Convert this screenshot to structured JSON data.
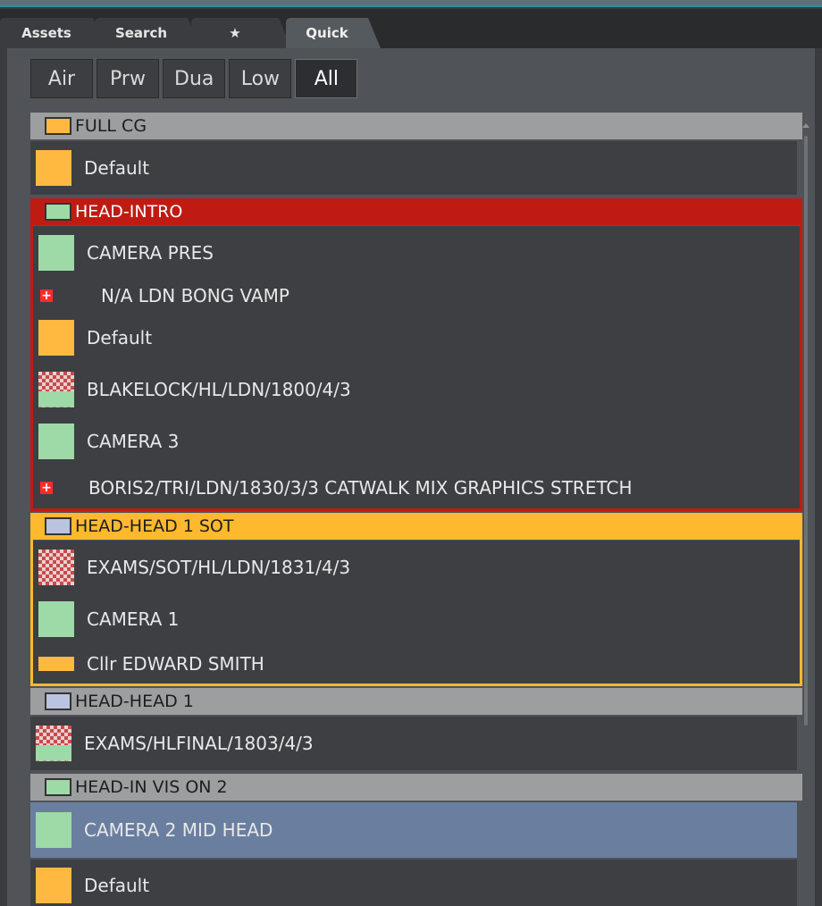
{
  "tabs": [
    {
      "label": "Assets",
      "active": false
    },
    {
      "label": "Search",
      "active": false
    },
    {
      "label": "★",
      "active": false
    },
    {
      "label": "Quick",
      "active": true
    }
  ],
  "filters": [
    {
      "label": "Air",
      "selected": false
    },
    {
      "label": "Prw",
      "selected": false
    },
    {
      "label": "Dua",
      "selected": false
    },
    {
      "label": "Low",
      "selected": false
    },
    {
      "label": "All",
      "selected": true
    }
  ],
  "groups": [
    {
      "title": "FULL CG",
      "swatch_color": "#ffb940",
      "style": "gray",
      "items": [
        {
          "label": "Default",
          "thumb": "orange-block",
          "selected": false
        }
      ]
    },
    {
      "title": "HEAD-INTRO",
      "swatch_color": "#9ed9a8",
      "style": "red",
      "items": [
        {
          "label": "CAMERA PRES",
          "thumb": "green-block",
          "selected": false
        },
        {
          "label": "N/A LDN BONG VAMP",
          "thumb": "red-plus",
          "selected": false
        },
        {
          "label": "Default",
          "thumb": "orange-block",
          "selected": false
        },
        {
          "label": "BLAKELOCK/HL/LDN/1800/4/3",
          "thumb": "checker-green",
          "selected": false
        },
        {
          "label": "CAMERA 3",
          "thumb": "green-block",
          "selected": false
        },
        {
          "label": "BORIS2/TRI/LDN/1830/3/3 CATWALK MIX GRAPHICS STRETCH",
          "thumb": "red-plus",
          "selected": false
        }
      ]
    },
    {
      "title": "HEAD-HEAD 1 SOT",
      "swatch_color": "#b9c4e0",
      "style": "yellow",
      "items": [
        {
          "label": "EXAMS/SOT/HL/LDN/1831/4/3",
          "thumb": "checker",
          "selected": false
        },
        {
          "label": "CAMERA 1",
          "thumb": "green-block",
          "selected": false
        },
        {
          "label": "Cllr EDWARD SMITH",
          "thumb": "orange-bar",
          "selected": false
        }
      ]
    },
    {
      "title": "HEAD-HEAD 1",
      "swatch_color": "#b9c4e0",
      "style": "gray",
      "items": [
        {
          "label": "EXAMS/HLFINAL/1803/4/3",
          "thumb": "checker-green",
          "selected": false
        }
      ]
    },
    {
      "title": "HEAD-IN VIS ON 2",
      "swatch_color": "#9ed9a8",
      "style": "gray",
      "items": [
        {
          "label": "CAMERA 2 MID HEAD",
          "thumb": "green-block",
          "selected": true
        },
        {
          "label": "Default",
          "thumb": "orange-block",
          "selected": false
        }
      ]
    }
  ]
}
